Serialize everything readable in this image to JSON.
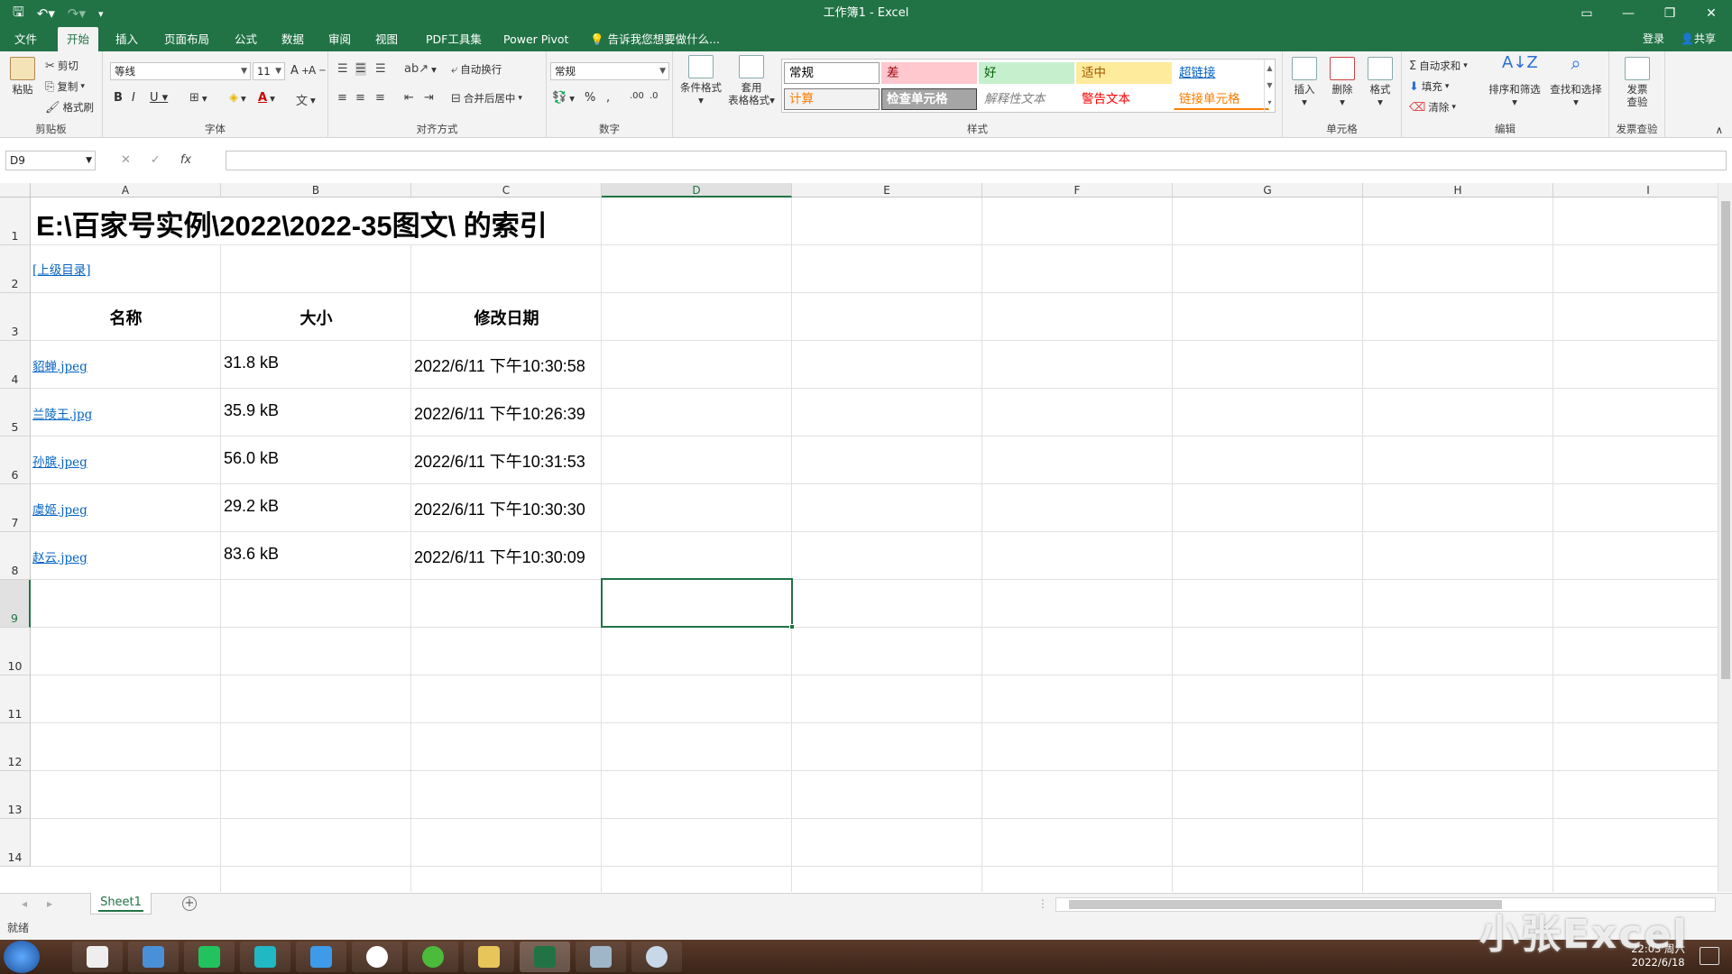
{
  "window": {
    "title": "工作簿1 - Excel"
  },
  "tabs": [
    {
      "label": "文件"
    },
    {
      "label": "开始"
    },
    {
      "label": "插入"
    },
    {
      "label": "页面布局"
    },
    {
      "label": "公式"
    },
    {
      "label": "数据"
    },
    {
      "label": "审阅"
    },
    {
      "label": "视图"
    },
    {
      "label": "PDF工具集"
    },
    {
      "label": "Power Pivot"
    }
  ],
  "tellme": "告诉我您想要做什么...",
  "account": {
    "login": "登录",
    "share": "共享"
  },
  "ribbon": {
    "clipboard": {
      "label": "剪贴板",
      "paste": "粘贴",
      "cut": "剪切",
      "copy": "复制",
      "format_painter": "格式刷"
    },
    "font": {
      "label": "字体",
      "name": "等线",
      "size": "11"
    },
    "alignment": {
      "label": "对齐方式",
      "wrap": "自动换行",
      "merge": "合并后居中"
    },
    "number": {
      "label": "数字",
      "format": "常规"
    },
    "styles": {
      "label": "样式",
      "conditional": "条件格式",
      "table1": "套用",
      "table2": "表格格式",
      "cells": [
        {
          "text": "常规",
          "bg": "#ffffff",
          "color": "#000000",
          "border": "#9a9a9a"
        },
        {
          "text": "差",
          "bg": "#ffc7ce",
          "color": "#9c0006",
          "border": "#ffc7ce"
        },
        {
          "text": "好",
          "bg": "#c6efce",
          "color": "#006100",
          "border": "#c6efce"
        },
        {
          "text": "适中",
          "bg": "#ffeb9c",
          "color": "#9c5700",
          "border": "#ffeb9c"
        },
        {
          "text": "超链接",
          "bg": "#ffffff",
          "color": "#0563c1",
          "border": "#ffffff"
        },
        {
          "text": "计算",
          "bg": "#f2f2f2",
          "color": "#fa7d00",
          "border": "#7f7f7f"
        },
        {
          "text": "检查单元格",
          "bg": "#a5a5a5",
          "color": "#ffffff",
          "border": "#3f3f3f"
        },
        {
          "text": "解释性文本",
          "bg": "#ffffff",
          "color": "#7f7f7f",
          "border": "#ffffff"
        },
        {
          "text": "警告文本",
          "bg": "#ffffff",
          "color": "#ff0000",
          "border": "#ffffff"
        },
        {
          "text": "链接单元格",
          "bg": "#ffffff",
          "color": "#fa7d00",
          "border": "#ffffff"
        }
      ]
    },
    "cells": {
      "label": "单元格",
      "insert": "插入",
      "delete": "删除",
      "format": "格式"
    },
    "editing": {
      "label": "编辑",
      "autosum": "自动求和",
      "fill": "填充",
      "clear": "清除",
      "sort": "排序和筛选",
      "find": "查找和选择"
    },
    "invoice": {
      "label": "发票查验",
      "btn1": "发票",
      "btn2": "查验"
    }
  },
  "formula_bar": {
    "namebox": "D9",
    "content": ""
  },
  "grid": {
    "columns": [
      "A",
      "B",
      "C",
      "D",
      "E",
      "F",
      "G",
      "H",
      "I"
    ],
    "rows": [
      "1",
      "2",
      "3",
      "4",
      "5",
      "6",
      "7",
      "8",
      "9",
      "10",
      "11",
      "12",
      "13",
      "14"
    ],
    "title": "E:\\百家号实例\\2022\\2022-35图文\\ 的索引",
    "parent_link": "[上级目录]",
    "headers": [
      "名称",
      "大小",
      "修改日期"
    ],
    "files": [
      {
        "name": "貂蝉.jpeg",
        "size": "31.8 kB",
        "modified": "2022/6/11 下午10:30:58"
      },
      {
        "name": "兰陵王.jpg",
        "size": "35.9 kB",
        "modified": "2022/6/11 下午10:26:39"
      },
      {
        "name": "孙膑.jpeg",
        "size": "56.0 kB",
        "modified": "2022/6/11 下午10:31:53"
      },
      {
        "name": "虞姬.jpeg",
        "size": "29.2 kB",
        "modified": "2022/6/11 下午10:30:30"
      },
      {
        "name": "赵云.jpeg",
        "size": "83.6 kB",
        "modified": "2022/6/11 下午10:30:09"
      }
    ],
    "selected_cell": "D9"
  },
  "sheet": {
    "name": "Sheet1"
  },
  "status": {
    "text": "就绪"
  },
  "taskbar": {
    "time": "22:03 周六",
    "date": "2022/6/18"
  },
  "watermark": "小张Excel"
}
